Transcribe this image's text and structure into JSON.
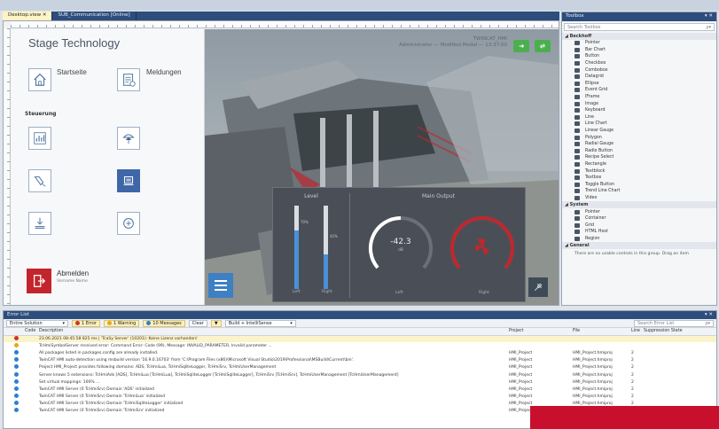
{
  "document_tabs": [
    {
      "label": "Desktop.view  ✕",
      "active": true
    },
    {
      "label": "SUB_Communication [Online]",
      "active": false
    }
  ],
  "hmi": {
    "app_title": "Stage Technology",
    "nav_top": [
      {
        "label": "Startseite",
        "icon": "home-icon"
      },
      {
        "label": "Meldungen",
        "icon": "messages-icon"
      }
    ],
    "section_label": "Steuerung",
    "logout": {
      "label": "Abmelden",
      "sub": "Vorname Name",
      "icon": "logout-icon"
    },
    "scene_header": {
      "line1": "TWINCAT_HMI",
      "line2": "Administrator — Modified Model — 13:37:00"
    },
    "gauges": {
      "level_title": "Level",
      "main_output_title": "Main Output",
      "level_bars": [
        {
          "label": "Left",
          "value_text": "70%",
          "fill_fraction": 0.7
        },
        {
          "label": "Right",
          "value_text": "42%",
          "fill_fraction": 0.42
        }
      ],
      "left_gauge": {
        "value": "-42.3",
        "unit": "dB",
        "label": "Left"
      },
      "right_gauge": {
        "value": "",
        "label": "Right"
      }
    }
  },
  "toolbox": {
    "title": "Toolbox",
    "header_glyphs": "▾ ✕",
    "search_placeholder": "Search Toolbox",
    "search_glyph": "ρ▾",
    "groups": [
      {
        "name": "◢ Beckhoff",
        "items": [
          "Pointer",
          "Bar Chart",
          "Button",
          "Checkbox",
          "Combobox",
          "Datagrid",
          "Ellipse",
          "Event Grid",
          "IFrame",
          "Image",
          "Keyboard",
          "Line",
          "Line Chart",
          "Linear Gauge",
          "Polygon",
          "Radial Gauge",
          "Radio Button",
          "Recipe Select",
          "Rectangle",
          "Textblock",
          "Textbox",
          "Toggle Button",
          "Trend Line Chart",
          "Video"
        ]
      },
      {
        "name": "◢ System",
        "items": [
          "Pointer",
          "Container",
          "Grid",
          "HTML Host",
          "Region"
        ]
      },
      {
        "name": "◢ General",
        "items": []
      }
    ],
    "general_note": "There are no usable controls in this group. Drag an item"
  },
  "error_list": {
    "title": "Error List",
    "header_glyphs": "▾ ✕",
    "scope": "Entire Solution",
    "errors": "1 Error",
    "warnings": "1 Warning",
    "messages": "10 Messages",
    "clear": "Clear",
    "build_filter": "Build + IntelliSense",
    "search_placeholder": "Search Error List",
    "search_glyph": "ρ▾",
    "columns": [
      "",
      "Code",
      "Description",
      "Project",
      "File",
      "Line",
      "Suppression State"
    ],
    "rows": [
      {
        "type": "error",
        "code": "",
        "desc": "23.06.2021 08:45:58 825 ms | 'TcaSy Server' (10201): Keine Lizenz vorhanden!",
        "project": "",
        "file": "",
        "line": ""
      },
      {
        "type": "warning",
        "code": "",
        "desc": "TcHmiSymbolServer received error: Command Error: Code (99), Message: INVALID_PARAMETER, Invalid parameter ...",
        "project": "",
        "file": "",
        "line": ""
      },
      {
        "type": "info",
        "code": "",
        "desc": "All packages listed in packages.config are already installed.",
        "project": "HMI_Project",
        "file": "HMI_Project.hmiproj",
        "line": "2"
      },
      {
        "type": "info",
        "code": "",
        "desc": "TwinCAT HMI auto-detection using msbuild version '16.9.0.16703' from 'C:\\Program Files (x86)\\Microsoft Visual Studio\\2019\\Professional\\MSBuild\\Current\\bin'.",
        "project": "HMI_Project",
        "file": "HMI_Project.hmiproj",
        "line": "2"
      },
      {
        "type": "info",
        "code": "",
        "desc": "Project HMI_Project provides following domains: ADS, TcHmiLua, TcHmiSqliteLogger, TcHmiSrv, TcHmiUserManagement",
        "project": "HMI_Project",
        "file": "HMI_Project.hmiproj",
        "line": "2"
      },
      {
        "type": "info",
        "code": "",
        "desc": "Server knows 5 extensions: TcHmiAds [ADS], TcHmiLua [TcHmiLua], TcHmiSqliteLogger [TcHmiSqliteLogger], TcHmiSrv [TcHmiSrv], TcHmiUserManagement [TcHmiUserManagement]",
        "project": "HMI_Project",
        "file": "HMI_Project.hmiproj",
        "line": "2"
      },
      {
        "type": "info",
        "code": "",
        "desc": "Set virtual mappings: 100% ...",
        "project": "HMI_Project",
        "file": "HMI_Project.hmiproj",
        "line": "2"
      },
      {
        "type": "info",
        "code": "",
        "desc": "TwinCAT HMI Server (0 TcHmiSrv) Domain 'ADS' initialized",
        "project": "HMI_Project",
        "file": "HMI_Project.hmiproj",
        "line": "2"
      },
      {
        "type": "info",
        "code": "",
        "desc": "TwinCAT HMI Server (0 TcHmiSrv) Domain 'TcHmiLua' initialized",
        "project": "HMI_Project",
        "file": "HMI_Project.hmiproj",
        "line": "2"
      },
      {
        "type": "info",
        "code": "",
        "desc": "TwinCAT HMI Server (0 TcHmiSrv) Domain 'TcHmiSqliteLogger' initialized",
        "project": "HMI_Project",
        "file": "HMI_Project.hmiproj",
        "line": "2"
      },
      {
        "type": "info",
        "code": "",
        "desc": "TwinCAT HMI Server (0 TcHmiSrv) Domain 'TcHmiSrv' initialized",
        "project": "HMI_Project",
        "file": "HMI_Project.hmiproj",
        "line": "2"
      }
    ]
  },
  "colors": {
    "accent": "#2d4d7c",
    "error": "#d0312d",
    "warning": "#e6a817",
    "info": "#2f7fd0",
    "logout": "#c3252c",
    "level_fill": "#4a90d9",
    "gauge_red": "#c0272d"
  }
}
